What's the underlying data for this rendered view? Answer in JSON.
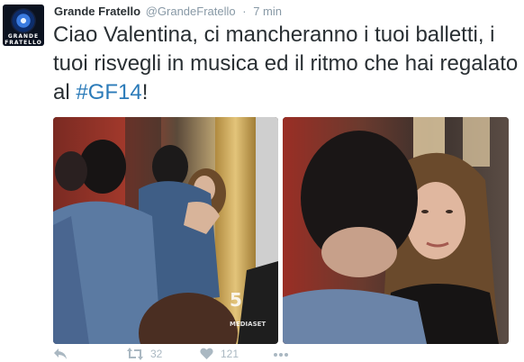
{
  "account": {
    "avatar_icon": "grande-fratello-eye-logo",
    "avatar_text_top": "GRANDE",
    "avatar_text_bottom": "FRATELLO",
    "display_name": "Grande Fratello",
    "handle": "@GrandeFratello",
    "separator": "·",
    "timestamp": "7 min"
  },
  "tweet": {
    "text_before_hashtag": "Ciao Valentina, ci mancheranno i tuoi balletti, i tuoi risvegli in musica ed il ritmo che hai regalato al ",
    "hashtag": "#GF14",
    "text_after_hashtag": "!"
  },
  "media": [
    {
      "description_icon": "photo-hug-scene",
      "watermark": "MEDIASET"
    },
    {
      "description_icon": "photo-emotional-closeup"
    }
  ],
  "actions": {
    "reply_icon": "reply-icon",
    "retweet_icon": "retweet-icon",
    "retweet_count": "32",
    "favorite_icon": "heart-icon",
    "favorite_count": "121",
    "more_icon": "more-dots-icon"
  },
  "colors": {
    "link": "#2b7bb9",
    "text": "#292f33",
    "muted": "#8899a6",
    "action_gray": "#aab8c2"
  }
}
